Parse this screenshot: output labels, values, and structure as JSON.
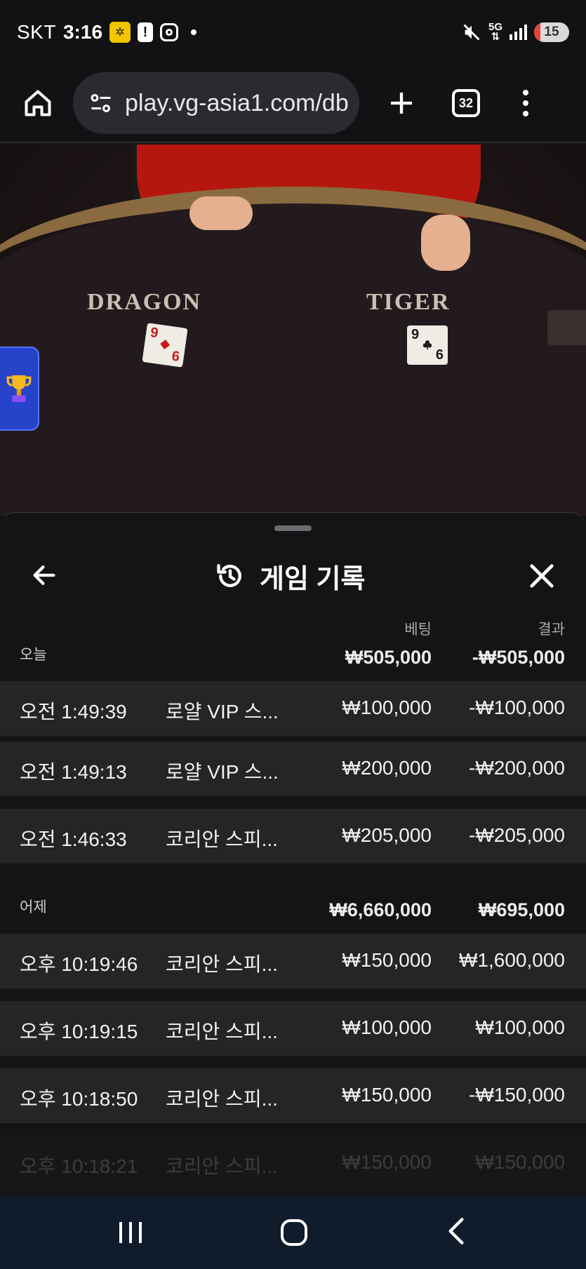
{
  "statusbar": {
    "carrier": "SKT",
    "time": "3:16",
    "network": "5G",
    "battery": "15"
  },
  "browser": {
    "url": "play.vg-asia1.com/db",
    "tab_count": "32"
  },
  "game": {
    "left_label": "DRAGON",
    "right_label": "TIGER",
    "dragon_card": {
      "rank": "9",
      "rank_bottom": "6"
    },
    "tiger_card": {
      "rank": "9",
      "rank_bottom": "6"
    }
  },
  "history": {
    "title": "게임 기록",
    "col_bet": "베팅",
    "col_result": "결과",
    "groups": [
      {
        "label": "오늘",
        "bet_total": "₩505,000",
        "result_total": "-₩505,000",
        "rows": [
          {
            "time": "오전 1:49:39",
            "game": "로얄 VIP 스...",
            "bet": "₩100,000",
            "result": "-₩100,000"
          },
          {
            "time": "오전 1:49:13",
            "game": "로얄 VIP 스...",
            "bet": "₩200,000",
            "result": "-₩200,000"
          },
          {
            "time": "오전 1:46:33",
            "game": "코리안 스피...",
            "bet": "₩205,000",
            "result": "-₩205,000"
          }
        ]
      },
      {
        "label": "어제",
        "bet_total": "₩6,660,000",
        "result_total": "₩695,000",
        "rows": [
          {
            "time": "오후 10:19:46",
            "game": "코리안 스피...",
            "bet": "₩150,000",
            "result": "₩1,600,000"
          },
          {
            "time": "오후 10:19:15",
            "game": "코리안 스피...",
            "bet": "₩100,000",
            "result": "₩100,000"
          },
          {
            "time": "오후 10:18:50",
            "game": "코리안 스피...",
            "bet": "₩150,000",
            "result": "-₩150,000"
          },
          {
            "time": "오후 10:18:21",
            "game": "코리안 스피...",
            "bet": "₩150,000",
            "result": "₩150,000"
          }
        ]
      }
    ]
  },
  "colors": {
    "sheet_bg": "#141416",
    "row_bg": "#252527",
    "nav_bg": "#101b2c",
    "trophy_button": "#2743c9"
  },
  "icons": {
    "home": "home-icon",
    "site_settings": "tune-icon",
    "new_tab": "plus-icon",
    "menu": "more-vert-icon",
    "back": "arrow-left-icon",
    "history": "history-icon",
    "close": "close-icon",
    "trophy": "trophy-icon"
  }
}
